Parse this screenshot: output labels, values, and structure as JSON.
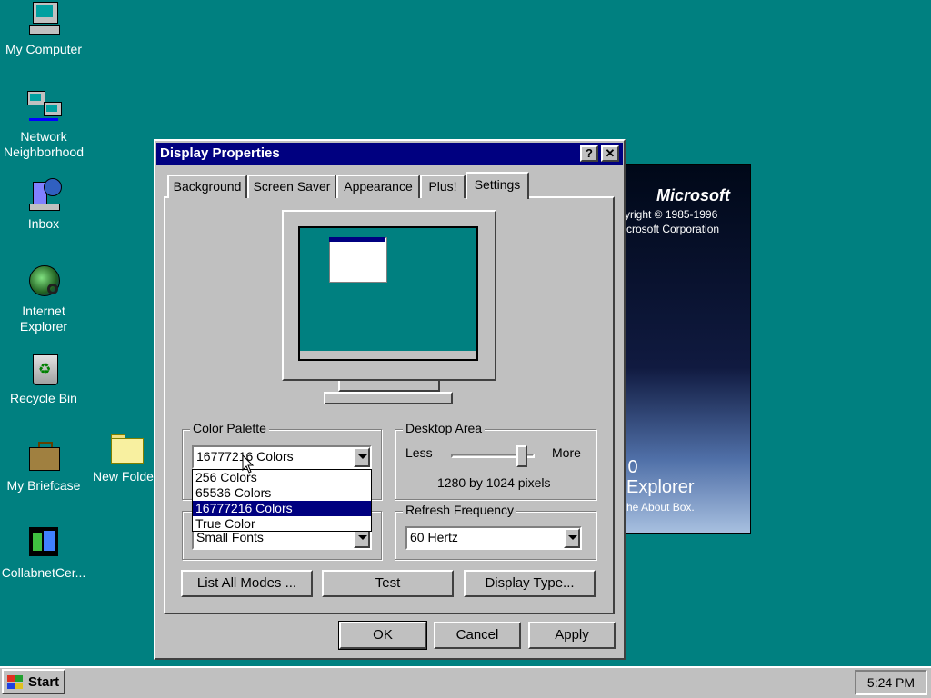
{
  "desktop": {
    "icons": [
      {
        "label": "My Computer"
      },
      {
        "label": "Network Neighborhood"
      },
      {
        "label": "Inbox"
      },
      {
        "label": "Internet Explorer"
      },
      {
        "label": "Recycle Bin"
      },
      {
        "label": "My Briefcase"
      },
      {
        "label": "New Folde"
      },
      {
        "label": "CollabnetCer..."
      }
    ]
  },
  "splash": {
    "brand": "Microsoft",
    "copyright": "yright © 1985-1996",
    "corp": "crosoft Corporation",
    "version": ".0",
    "product": "Explorer",
    "about": "he About Box."
  },
  "dialog": {
    "title": "Display Properties",
    "help_label": "?",
    "close_label": "✕",
    "tabs": [
      "Background",
      "Screen Saver",
      "Appearance",
      "Plus!",
      "Settings"
    ],
    "active_tab": "Settings",
    "color_palette": {
      "label": "Color Palette",
      "selected": "16777216 Colors",
      "options": [
        "256 Colors",
        "65536 Colors",
        "16777216 Colors",
        "True Color"
      ],
      "highlighted": "16777216 Colors"
    },
    "font_size": {
      "selected": "Small Fonts"
    },
    "desktop_area": {
      "label": "Desktop Area",
      "less": "Less",
      "more": "More",
      "resolution": "1280 by 1024 pixels",
      "slider_fraction": 0.9
    },
    "refresh": {
      "label": "Refresh Frequency",
      "selected": "60 Hertz"
    },
    "buttons": {
      "list_modes": "List All Modes ...",
      "test": "Test",
      "display_type": "Display Type...",
      "ok": "OK",
      "cancel": "Cancel",
      "apply": "Apply"
    }
  },
  "taskbar": {
    "start": "Start",
    "clock": "5:24 PM"
  },
  "colors": {
    "desktop": "#008080",
    "title_bar": "#000080",
    "face": "#c0c0c0",
    "highlight": "#000080"
  }
}
